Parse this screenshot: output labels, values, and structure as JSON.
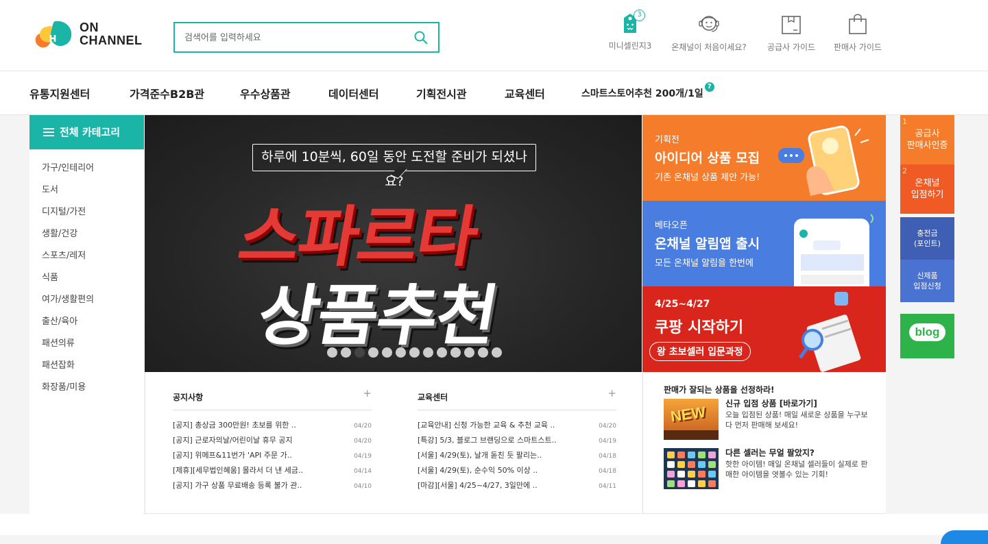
{
  "brand": {
    "line1": "ON",
    "line2": "CHANNEL",
    "colors": {
      "accent": "#1bb5a8",
      "orange": "#f57c2b",
      "red": "#d9261c",
      "blue": "#4a7de0"
    }
  },
  "search": {
    "placeholder": "검색어를 입력하세요",
    "icon": "search-icon"
  },
  "top_links": [
    {
      "label": "미니셀린지3",
      "icon": "price-tag-icon",
      "badge": "3"
    },
    {
      "label": "온채널이 처음이세요?",
      "icon": "support-agent-icon"
    },
    {
      "label": "공급사 가이드",
      "icon": "box-icon"
    },
    {
      "label": "판매사 가이드",
      "icon": "shopping-bag-icon"
    }
  ],
  "gnb": [
    {
      "label": "유통지원센터"
    },
    {
      "label": "가격준수B2B관"
    },
    {
      "label": "우수상품관"
    },
    {
      "label": "데이터센터"
    },
    {
      "label": "기획전시관"
    },
    {
      "label": "교육센터"
    },
    {
      "label": "스마트스토어추천 200개/1일",
      "help": "?"
    }
  ],
  "category": {
    "title": "전체 카테고리",
    "items": [
      "가구/인테리어",
      "도서",
      "디지털/가전",
      "생활/건강",
      "스포츠/레저",
      "식품",
      "여가/생활편의",
      "출산/육아",
      "패션의류",
      "패션잡화",
      "화장품/미용"
    ]
  },
  "main_banner": {
    "bubble": "하루에 10분씩, 60일 동안 도전할 준비가 되셨나요?",
    "line1": "스파르타",
    "line2": "상품추천",
    "dots_total": 13,
    "active_dot": 2
  },
  "side_banners": [
    {
      "tag": "기획전",
      "title": "아이디어 상품 모집",
      "sub": "기존 온채널 상품 제안 가능!",
      "bg": "#f57c2b"
    },
    {
      "tag": "베타오픈",
      "title": "온채널 알림앱 출시",
      "sub": "모든 온채널 알림을 한번에",
      "bg": "#4a7de0"
    },
    {
      "tag": "4/25~4/27",
      "title": "쿠팡 시작하기",
      "sub": "왕 초보셀러 입문과정",
      "bg": "#d9261c"
    }
  ],
  "right_rail": [
    {
      "num": "1",
      "label1": "공급사",
      "label2": "판매사인증",
      "bg": "#f57c2b"
    },
    {
      "num": "2",
      "label1": "온채널",
      "label2": "입점하기",
      "bg": "#f05a24"
    },
    {
      "label1": "충전금",
      "label2": "(포인트)",
      "bg": "#3f5fb5"
    },
    {
      "label1": "신제품",
      "label2": "입점신청",
      "bg": "#4a72d1"
    },
    {
      "label1": "blog",
      "bg": "#2db34a"
    }
  ],
  "notice": {
    "title": "공지사항",
    "more": "+",
    "items": [
      {
        "text": "[공지] 총상금 300만원! 초보를 위한 ..",
        "date": "04/20"
      },
      {
        "text": "[공지] 근로자의날/어린이날 휴무 공지",
        "date": "04/20"
      },
      {
        "text": "[공지] 위메프&11번가 'API 주문 가..",
        "date": "04/19"
      },
      {
        "text": "[제휴][세무법인혜움] 몰라서 더 낸 세금..",
        "date": "04/14"
      },
      {
        "text": "[공지] 가구 상품 무료배송 등록 불가 관..",
        "date": "04/10"
      }
    ]
  },
  "education": {
    "title": "교육센터",
    "more": "+",
    "items": [
      {
        "text": "[교육안내] 신청 가능한 교육 & 추천 교육 ..",
        "date": "04/20"
      },
      {
        "text": "[특강] 5/3, 블로그 브랜딩으로 스마트스트..",
        "date": "04/19"
      },
      {
        "text": "[서울] 4/29(토), 날개 돋친 듯 팔리는..",
        "date": "04/18"
      },
      {
        "text": "[서울] 4/29(토), 순수익 50% 이상 ..",
        "date": "04/18"
      },
      {
        "text": "[마감][서울] 4/25~4/27, 3일만에 ..",
        "date": "04/11"
      }
    ]
  },
  "pick": {
    "title": "판매가 잘되는 상품을 선정하라!",
    "items": [
      {
        "head": "신규 입점 상품 [바로가기]",
        "body": "오늘 입점된 상품! 매일 새로운 상품을 누구보다 먼저 판매해 보세요!",
        "img_text": "NEW"
      },
      {
        "head": "다른 셀러는 무얼 팔았지?",
        "body": "핫한 아이템! 매일 온채널 셀러들이 실제로 판매한 아이템을 엿볼수 있는 기회!"
      }
    ]
  }
}
